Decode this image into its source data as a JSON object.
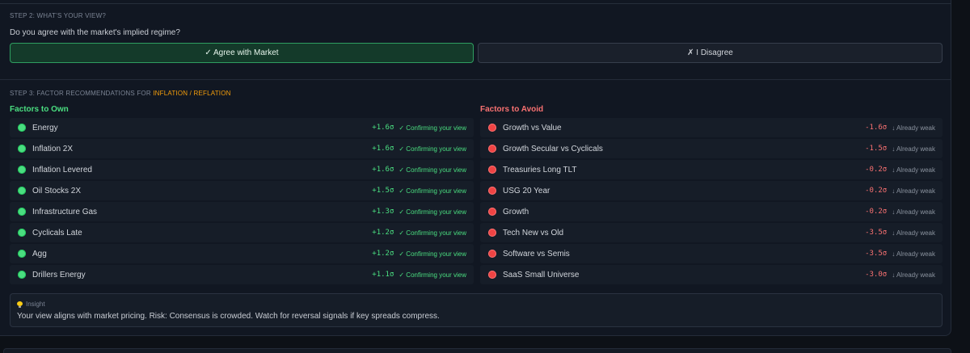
{
  "step2": {
    "label": "STEP 2: WHAT'S YOUR VIEW?",
    "question": "Do you agree with the market's implied regime?",
    "agree_label": "✓ Agree with Market",
    "disagree_label": "✗ I Disagree"
  },
  "step3": {
    "label_prefix": "STEP 3: FACTOR RECOMMENDATIONS FOR ",
    "regime": "INFLATION / REFLATION"
  },
  "own": {
    "heading": "Factors to Own",
    "items": [
      {
        "name": "Energy",
        "sigma": "+1.6σ",
        "status": "✓ Confirming your view"
      },
      {
        "name": "Inflation 2X",
        "sigma": "+1.6σ",
        "status": "✓ Confirming your view"
      },
      {
        "name": "Inflation Levered",
        "sigma": "+1.6σ",
        "status": "✓ Confirming your view"
      },
      {
        "name": "Oil Stocks 2X",
        "sigma": "+1.5σ",
        "status": "✓ Confirming your view"
      },
      {
        "name": "Infrastructure Gas",
        "sigma": "+1.3σ",
        "status": "✓ Confirming your view"
      },
      {
        "name": "Cyclicals Late",
        "sigma": "+1.2σ",
        "status": "✓ Confirming your view"
      },
      {
        "name": "Agg",
        "sigma": "+1.2σ",
        "status": "✓ Confirming your view"
      },
      {
        "name": "Drillers Energy",
        "sigma": "+1.1σ",
        "status": "✓ Confirming your view"
      }
    ]
  },
  "avoid": {
    "heading": "Factors to Avoid",
    "items": [
      {
        "name": "Growth vs Value",
        "sigma": "-1.6σ",
        "status": "↓ Already weak"
      },
      {
        "name": "Growth Secular vs Cyclicals",
        "sigma": "-1.5σ",
        "status": "↓ Already weak"
      },
      {
        "name": "Treasuries Long TLT",
        "sigma": "-0.2σ",
        "status": "↓ Already weak"
      },
      {
        "name": "USG 20 Year",
        "sigma": "-0.2σ",
        "status": "↓ Already weak"
      },
      {
        "name": "Growth",
        "sigma": "-0.2σ",
        "status": "↓ Already weak"
      },
      {
        "name": "Tech New vs Old",
        "sigma": "-3.5σ",
        "status": "↓ Already weak"
      },
      {
        "name": "Software vs Semis",
        "sigma": "-3.5σ",
        "status": "↓ Already weak"
      },
      {
        "name": "SaaS Small Universe",
        "sigma": "-3.0σ",
        "status": "↓ Already weak"
      }
    ]
  },
  "insight": {
    "label": "Insight",
    "icon": "lightbulb-icon",
    "text": "Your view aligns with market pricing. Risk: Consensus is crowded. Watch for reversal signals if key spreads compress."
  },
  "colors": {
    "positive": "#4ade80",
    "negative": "#f87171",
    "regime": "#f59e0b"
  }
}
